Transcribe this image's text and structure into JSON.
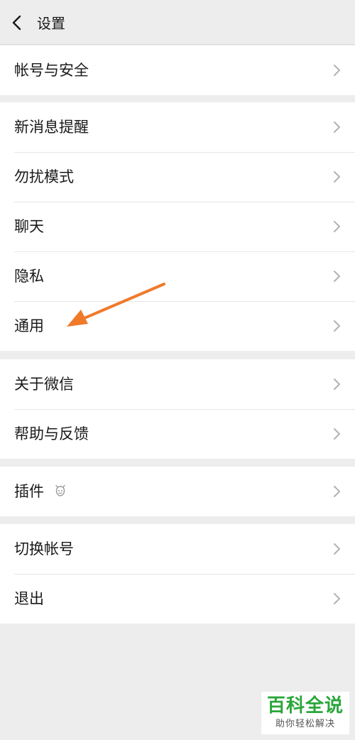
{
  "header": {
    "title": "设置",
    "back_icon": "chevron-left-icon"
  },
  "groups": [
    {
      "items": [
        {
          "label": "帐号与安全"
        }
      ]
    },
    {
      "items": [
        {
          "label": "新消息提醒"
        },
        {
          "label": "勿扰模式"
        },
        {
          "label": "聊天"
        },
        {
          "label": "隐私"
        },
        {
          "label": "通用"
        }
      ]
    },
    {
      "items": [
        {
          "label": "关于微信"
        },
        {
          "label": "帮助与反馈"
        }
      ]
    },
    {
      "items": [
        {
          "label": "插件",
          "icon": "plugin-icon"
        }
      ]
    },
    {
      "items": [
        {
          "label": "切换帐号"
        },
        {
          "label": "退出"
        }
      ]
    }
  ],
  "row_chevron_icon": "chevron-right-icon",
  "annotation": {
    "icon": "orange-arrow-icon",
    "color": "#f07a2a"
  },
  "watermark": {
    "main": "百科全说",
    "sub": "助你轻松解决",
    "color": "#2aa63a"
  }
}
